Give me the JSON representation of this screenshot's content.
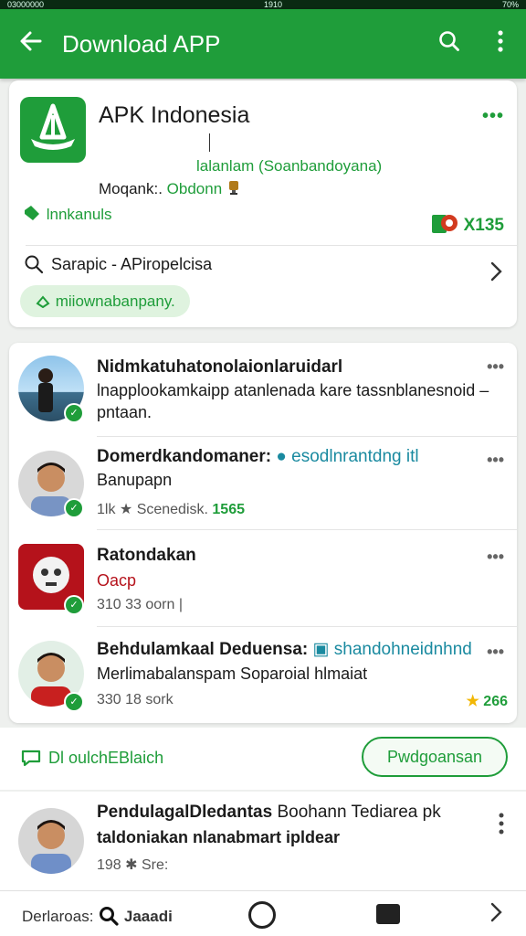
{
  "status_bar": {
    "left": "03000000",
    "center": "1910",
    "right": "70%"
  },
  "app_bar": {
    "title": "Download APP"
  },
  "app_card": {
    "name": "APK Indonesia",
    "developer": "lalanlam (Soanbandoyana)",
    "meta_label": "Moqank:.",
    "meta_value": "Obdonn",
    "install_label": "lnnkanuls",
    "count": "X135",
    "search_text": "Sarapic - APiropelcisa",
    "pill_label": "miiownabanpany."
  },
  "feed": [
    {
      "title": "Nidmkatuhatonolaionlaruidarl",
      "link": "",
      "sub": "lnapplookamkaipp atanlenada kare tassnblanesnoid –",
      "sub2": "pntaan.",
      "meta": "",
      "meta_value": ""
    },
    {
      "title": "Domerdkandomaner:",
      "link": "esodlnrantdng itl",
      "sub": "Banupapn",
      "sub2": "",
      "meta": "1lk ★ Scenedisk.",
      "meta_value": "1565"
    },
    {
      "title": "Ratondakan",
      "link": "",
      "sub": "Oacp",
      "sub2": "",
      "meta": "310 33 oorn |",
      "meta_value": ""
    },
    {
      "title": "Behdulamkaal Deduensa:",
      "link": "shandohneidnhnd",
      "sub": "Merlimabalanspam Soparoial hlmaiat",
      "sub2": "",
      "meta": "330 18 sork",
      "meta_value": "266"
    }
  ],
  "action_bar": {
    "label": "Dl oulchEBlaich",
    "button": "Pwdgoansan"
  },
  "bottom_item": {
    "title": "PendulagalDledantas",
    "title_link": "Boohann Tediarea pk",
    "sub": "taldoniakan nlanabmart ipldear",
    "meta": "198 ✱ Sre:"
  },
  "nav": {
    "label": "Derlaroas:",
    "search": "Jaaadi"
  },
  "colors": {
    "primary": "#1f9d3a",
    "link": "#1a8aa0",
    "star": "#f2b705"
  },
  "icons": [
    "back-arrow-icon",
    "search-icon",
    "more-vert-icon",
    "more-horiz-icon",
    "chevron-right-icon",
    "verified-badge-icon",
    "star-icon",
    "home-circle-icon",
    "bookmark-icon"
  ]
}
